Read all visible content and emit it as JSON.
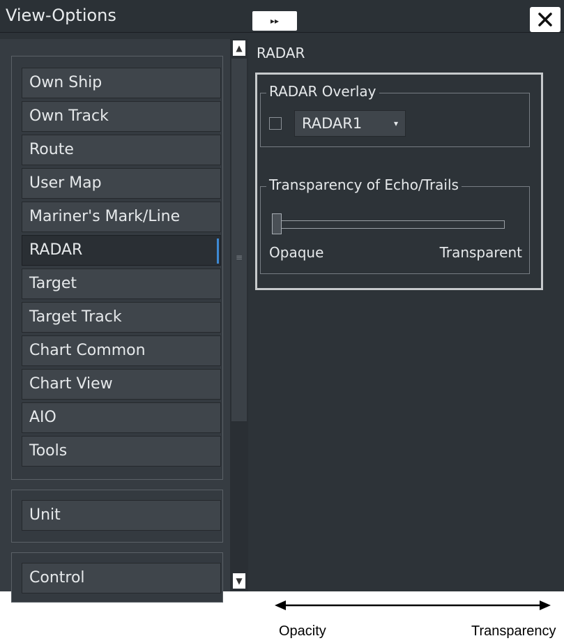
{
  "window": {
    "title": "View-Options",
    "expand_label": "▸▸",
    "close_label": "✕"
  },
  "sidebar": {
    "items": [
      {
        "label": "Own Ship"
      },
      {
        "label": "Own Track"
      },
      {
        "label": "Route"
      },
      {
        "label": "User Map"
      },
      {
        "label": "Mariner's Mark/Line"
      },
      {
        "label": "RADAR",
        "active": true
      },
      {
        "label": "Target"
      },
      {
        "label": "Target Track"
      },
      {
        "label": "Chart Common"
      },
      {
        "label": "Chart View"
      },
      {
        "label": "AIO"
      },
      {
        "label": "Tools"
      }
    ],
    "unit_label": "Unit",
    "control_label": "Control"
  },
  "scroll": {
    "up_label": "▲",
    "down_label": "▼",
    "grip": "≡"
  },
  "radar": {
    "section_title": "RADAR",
    "overlay": {
      "legend": "RADAR Overlay",
      "checked": false,
      "selected": "RADAR1",
      "caret": "▾"
    },
    "transparency": {
      "legend": "Transparency of Echo/Trails",
      "value": 0,
      "min_label": "Opaque",
      "max_label": "Transparent"
    }
  },
  "annotation": {
    "left": "Opacity",
    "right": "Transparency"
  },
  "colors": {
    "background": "#2d3338",
    "accent": "#3e8ad4",
    "text": "#e6e9eb"
  }
}
